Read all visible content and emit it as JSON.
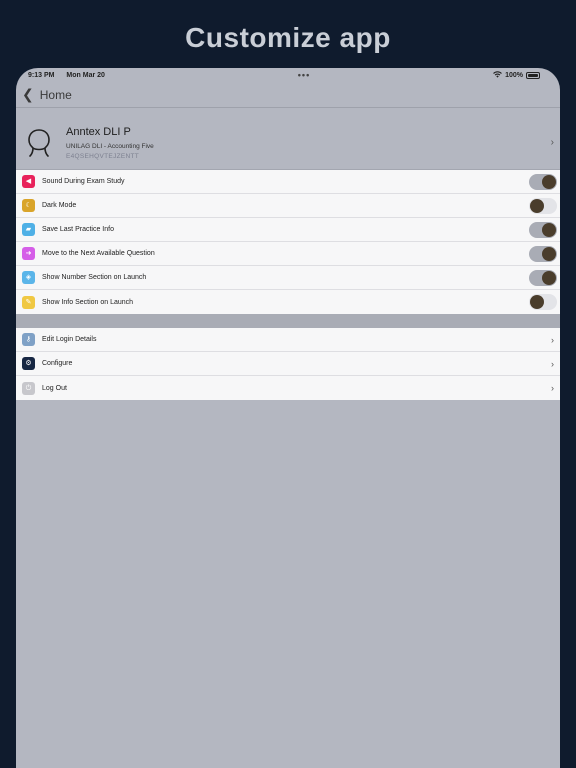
{
  "banner": {
    "title": "Customize app"
  },
  "status": {
    "time": "9:13 PM",
    "date": "Mon Mar 20",
    "battery": "100%"
  },
  "nav": {
    "back_label": "Home"
  },
  "profile": {
    "name": "Anntex DLI P",
    "subtitle": "UNILAG DLI - Accounting Five",
    "code": "E4QSEHQVTEJZENTT"
  },
  "settings": [
    {
      "label": "Sound During Exam Study",
      "icon": "speaker-icon",
      "color": "#e8225b",
      "on": true
    },
    {
      "label": "Dark Mode",
      "icon": "moon-icon",
      "color": "#d9a42a",
      "on": false
    },
    {
      "label": "Save Last Practice Info",
      "icon": "save-icon",
      "color": "#4fb0e6",
      "on": true
    },
    {
      "label": "Move to the Next Available Question",
      "icon": "arrow-icon",
      "color": "#d55ee8",
      "on": true
    },
    {
      "label": "Show Number Section on Launch",
      "icon": "layers-icon",
      "color": "#5bb5e9",
      "on": true
    },
    {
      "label": "Show Info Section on Launch",
      "icon": "info-icon",
      "color": "#f0c843",
      "on": false
    }
  ],
  "actions": [
    {
      "label": "Edit Login Details",
      "icon": "key-icon",
      "color": "#7fa1c6"
    },
    {
      "label": "Configure",
      "icon": "gear-icon",
      "color": "#172743"
    },
    {
      "label": "Log Out",
      "icon": "logout-icon",
      "color": "#c7c7cc"
    }
  ]
}
